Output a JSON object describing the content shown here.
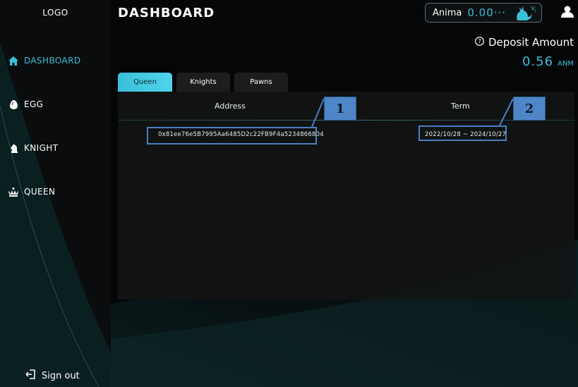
{
  "sidebar": {
    "logo": "LOGO",
    "items": [
      {
        "label": "DASHBOARD",
        "icon": "home-icon",
        "active": true
      },
      {
        "label": "EGG",
        "icon": "egg-icon",
        "active": false
      },
      {
        "label": "KNIGHT",
        "icon": "knight-icon",
        "active": false
      },
      {
        "label": "QUEEN",
        "icon": "queen-icon",
        "active": false
      }
    ],
    "signout_label": "Sign out"
  },
  "header": {
    "title": "DASHBOARD",
    "wallet": {
      "label": "Anima",
      "amount": "0.00···"
    }
  },
  "deposit": {
    "label": "Deposit Amount",
    "value": "0.56",
    "unit": "ANM"
  },
  "tabs": [
    {
      "label": "Queen",
      "active": true
    },
    {
      "label": "Knights",
      "active": false
    },
    {
      "label": "Pawns",
      "active": false
    }
  ],
  "table": {
    "columns": [
      "Address",
      "Term"
    ],
    "rows": [
      {
        "address": "0x81ee76e5B7995Aa6485D2c22FB9F4a5234866804",
        "term": "2022/10/28 ~ 2024/10/27"
      }
    ]
  },
  "annotations": [
    "1",
    "2"
  ],
  "colors": {
    "accent": "#3bbfd9",
    "annotation": "#4e86c7"
  }
}
